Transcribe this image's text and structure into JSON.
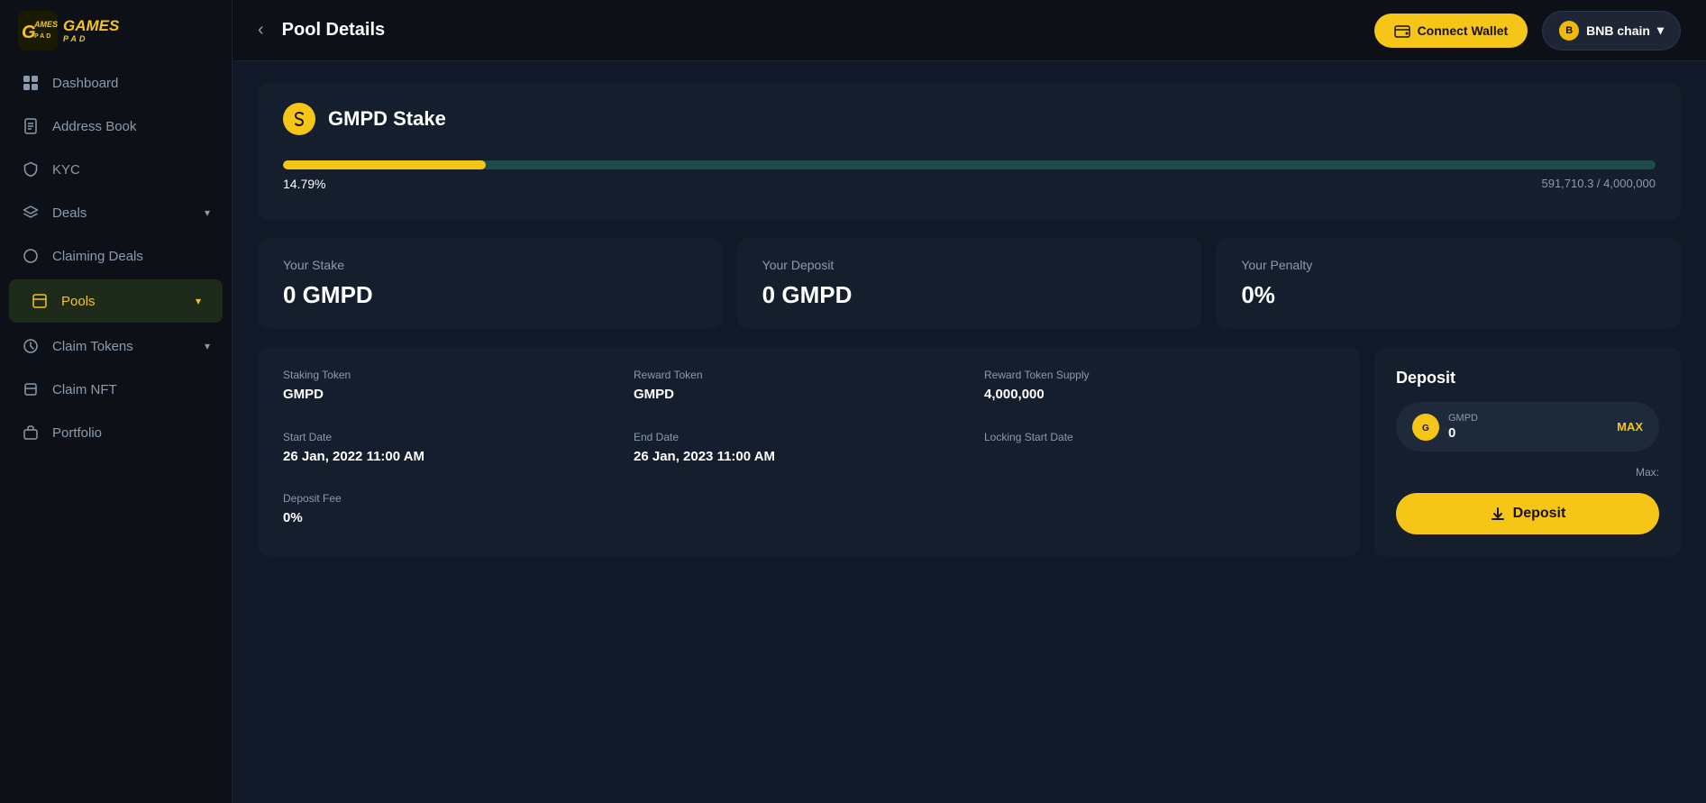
{
  "app": {
    "logo_top": "GAMES",
    "logo_bottom": "PAD"
  },
  "header": {
    "back_label": "‹",
    "title": "Pool Details",
    "connect_wallet_label": "Connect Wallet",
    "bnb_chain_label": "BNB chain",
    "bnb_chain_chevron": "▾"
  },
  "sidebar": {
    "items": [
      {
        "id": "dashboard",
        "label": "Dashboard",
        "icon": "grid"
      },
      {
        "id": "address-book",
        "label": "Address Book",
        "icon": "book"
      },
      {
        "id": "kyc",
        "label": "KYC",
        "icon": "shield"
      },
      {
        "id": "deals",
        "label": "Deals",
        "icon": "layers",
        "has_chevron": true
      },
      {
        "id": "claiming-deals",
        "label": "Claiming Deals",
        "icon": "circle"
      },
      {
        "id": "pools",
        "label": "Pools",
        "icon": "box",
        "active": true,
        "has_chevron": true
      },
      {
        "id": "claim-tokens",
        "label": "Claim Tokens",
        "icon": "circle2",
        "has_chevron": true
      },
      {
        "id": "claim-nft",
        "label": "Claim NFT",
        "icon": "layers2"
      },
      {
        "id": "portfolio",
        "label": "Portfolio",
        "icon": "briefcase"
      }
    ]
  },
  "pool": {
    "icon_symbol": "S",
    "name": "GMPD Stake",
    "progress_pct": 14.79,
    "progress_pct_label": "14.79%",
    "progress_filled": "591,710.3 / 4,000,000",
    "progress_bar_pct": 14.79
  },
  "stats": [
    {
      "label": "Your Stake",
      "value": "0 GMPD"
    },
    {
      "label": "Your Deposit",
      "value": "0 GMPD"
    },
    {
      "label": "Your Penalty",
      "value": "0%"
    }
  ],
  "details": [
    {
      "label": "Staking Token",
      "value": "GMPD"
    },
    {
      "label": "Reward Token",
      "value": "GMPD"
    },
    {
      "label": "Reward Token Supply",
      "value": "4,000,000"
    },
    {
      "label": "Start Date",
      "value": "26 Jan, 2022 11:00 AM"
    },
    {
      "label": "End Date",
      "value": "26 Jan, 2023 11:00 AM"
    },
    {
      "label": "Locking Start Date",
      "value": ""
    },
    {
      "label": "Deposit Fee",
      "value": "0%"
    },
    {
      "label": "",
      "value": ""
    },
    {
      "label": "",
      "value": ""
    }
  ],
  "deposit": {
    "title": "Deposit",
    "token_icon": "G",
    "token_label": "GMPD",
    "input_value": "0",
    "max_btn_label": "MAX",
    "max_label": "Max:",
    "button_label": "Deposit"
  }
}
